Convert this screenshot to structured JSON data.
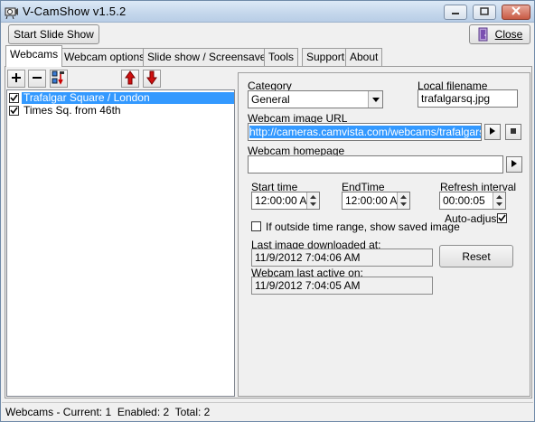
{
  "window": {
    "title": "V-CamShow v1.5.2",
    "buttons": {
      "minimize": "—",
      "maximize": "□",
      "close": "✕"
    }
  },
  "toolbar": {
    "start_slideshow": "Start Slide Show",
    "close_label": "Close"
  },
  "tabs": [
    {
      "label": "Webcams",
      "active": true
    },
    {
      "label": "Webcam options",
      "active": false
    },
    {
      "label": "Slide show / Screensaver",
      "active": false
    },
    {
      "label": "Tools",
      "active": false
    },
    {
      "label": "Support",
      "active": false
    },
    {
      "label": "About",
      "active": false
    }
  ],
  "list_tools": {
    "add": "+",
    "remove": "−"
  },
  "webcams": [
    {
      "name": "Trafalgar Square / London",
      "checked": true,
      "selected": true
    },
    {
      "name": "Times Sq. from 46th",
      "checked": true,
      "selected": false
    }
  ],
  "details": {
    "category_label": "Category",
    "category_value": "General",
    "local_filename_label": "Local filename",
    "local_filename_value": "trafalgarsq.jpg",
    "url_label": "Webcam image URL",
    "url_value": "http://cameras.camvista.com/webcams/trafalgarsq.jpg",
    "homepage_label": "Webcam homepage",
    "homepage_value": "",
    "start_time_label": "Start time",
    "start_time_value": "12:00:00 A",
    "end_time_label": "EndTime",
    "end_time_value": "12:00:00 A",
    "refresh_label": "Refresh interval",
    "refresh_value": "00:00:05",
    "auto_adjust_label": "Auto-adjust",
    "auto_adjust_checked": true,
    "outside_range_label": "If outside time range, show saved image",
    "outside_range_checked": false,
    "last_download_label": "Last image downloaded at:",
    "last_download_value": "11/9/2012 7:04:06 AM",
    "last_active_label": "Webcam last active on:",
    "last_active_value": "11/9/2012 7:04:05 AM",
    "reset_label": "Reset"
  },
  "status": "Webcams - Current: 1  Enabled: 2  Total: 2",
  "colors": {
    "selection": "#3399ff",
    "titlebar": "#c6d8ec",
    "arrow_red": "#d01010"
  }
}
